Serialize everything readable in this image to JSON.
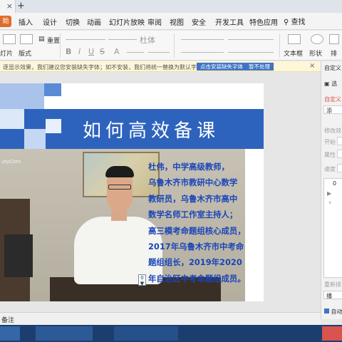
{
  "tabs": {
    "new_tab": "+"
  },
  "menu": {
    "start_label": "始",
    "items": [
      "插入",
      "设计",
      "切换",
      "动画",
      "幻灯片放映",
      "审阅",
      "视图",
      "安全",
      "开发工具",
      "特色应用"
    ],
    "search_label": "查找"
  },
  "ribbon": {
    "reset": "重置",
    "new_slide": "灯片",
    "layout": "版式",
    "font_name": "杜体",
    "format_buttons": [
      "B",
      "I",
      "U",
      "S",
      "A"
    ],
    "textbox": "文本框",
    "shape": "形状",
    "arrange": "排"
  },
  "notify": {
    "message": "逐显示效果，我们建议您安装缺失字体；如不安装，我们将统一替换为默认字体。",
    "install_button": "点击安装缺失字体",
    "ignore_button": "暂不处理",
    "close": "×"
  },
  "panel": {
    "header": "自定义",
    "select": "选",
    "custom": "自定义",
    "add": "添",
    "modify": "修改效",
    "start": "开始",
    "property": "属性",
    "speed": "速度",
    "list_value": "0",
    "preview": "播",
    "replay": "重新排",
    "auto": "自动"
  },
  "slide": {
    "title": "如何高效备课",
    "watermark": "utyCom",
    "badge": "0",
    "bio_lines": [
      "杜伟，中学高级教师，",
      "乌鲁木齐市教研中心数学",
      "教研员，乌鲁木齐市高中",
      "数学名师工作室主持人；",
      "高三模考命题组核心成员，",
      "2017年乌鲁木齐市中考命",
      "题组组长，2019年2020",
      "年自治区中考命题组成员。"
    ]
  },
  "notes": {
    "label": "备注"
  },
  "colors": {
    "banner": "#2e63bd",
    "bio_text": "#1a46b8",
    "notify_bg": "#fdf6d8",
    "start_tab": "#e06c2c"
  }
}
